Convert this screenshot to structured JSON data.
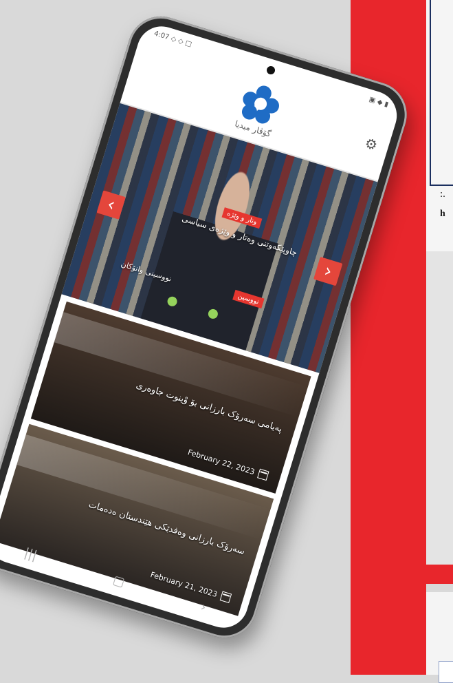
{
  "background": {
    "side_text_1": ":.",
    "side_text_2": "h"
  },
  "status_bar": {
    "left": "4:07 ◇ ◇ □",
    "right": "▣ ◆ ▮"
  },
  "header": {
    "logo_text": "گۆڤار میدیا",
    "gear_icon": "⚙"
  },
  "slider": {
    "tag_top": "وتار و وێژە",
    "title": "چاوپێکەوتنی وەتار و وێژەی سیاسی",
    "tag_bottom": "نووسین",
    "subtitle": "نووسینی وانۆكان",
    "left_arrow": "‹",
    "right_arrow": "›"
  },
  "cards": [
    {
      "headline": "پەیامی سەرۆک بارزانی بۆ وْینوت جاوەری",
      "date": "February 22, 2023"
    },
    {
      "headline": "سەرۆک بارزانی وەفدێکی هێندستان ەدەمات",
      "date": "February 21, 2023"
    }
  ],
  "navbar": {
    "left": "|||",
    "center": "▢",
    "right": "›"
  }
}
